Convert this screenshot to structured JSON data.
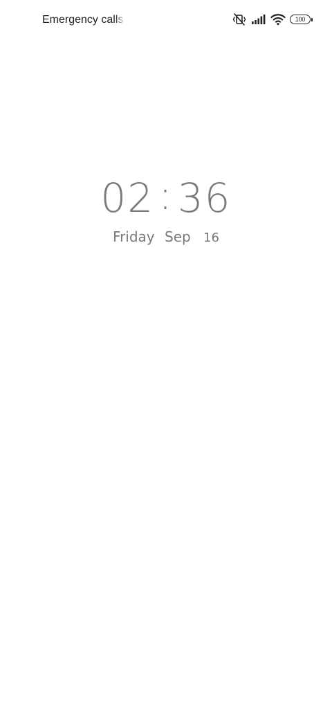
{
  "status_bar": {
    "carrier_text": "Emergency calls o",
    "icons": [
      "vibrate-off-icon",
      "cellular-signal-icon",
      "wifi-icon",
      "battery-icon"
    ],
    "battery_level": "100"
  },
  "lock_screen": {
    "clock": {
      "hours": "02",
      "separator": ":",
      "minutes": "36"
    },
    "date": {
      "weekday": "Friday",
      "month": "Sep",
      "day": "16"
    }
  },
  "colors": {
    "background": "#ffffff",
    "clock_text": "#7a7a7a",
    "status_text": "#1f1f1f"
  }
}
